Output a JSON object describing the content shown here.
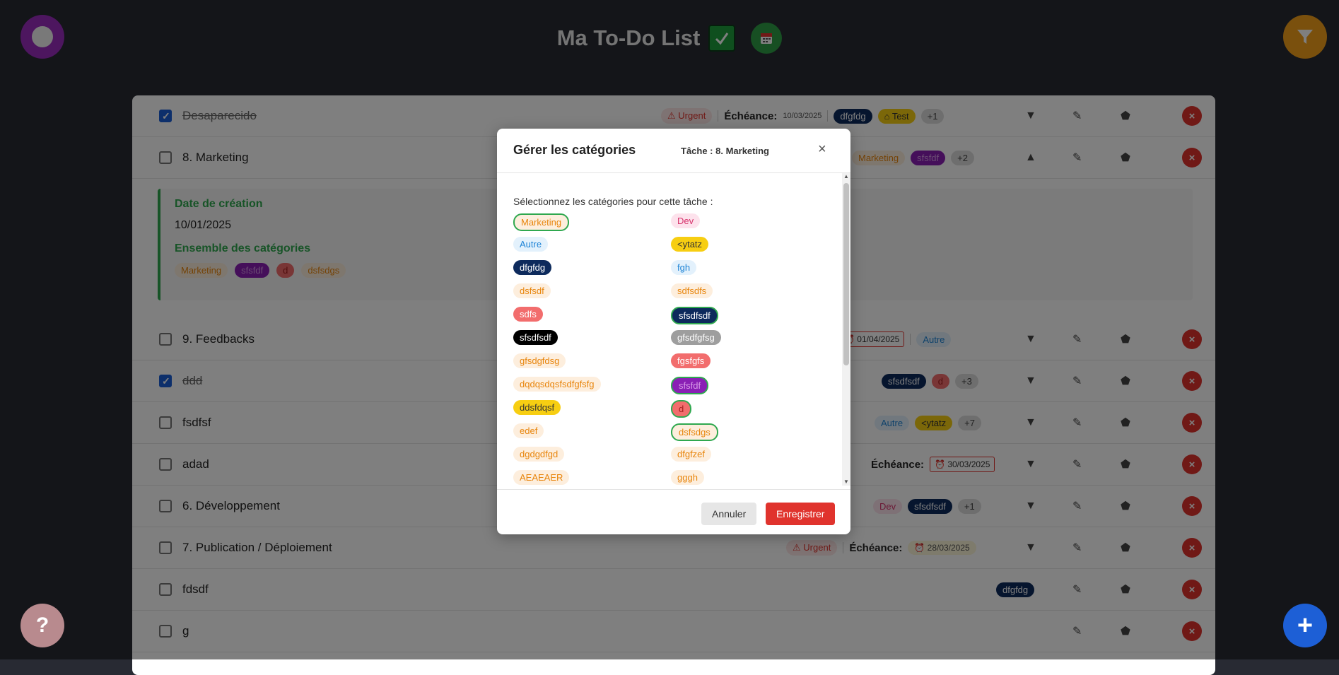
{
  "app": {
    "title": "Ma To-Do List"
  },
  "help_label": "?",
  "add_label": "+",
  "due_label": "Échéance:",
  "tasks": [
    {
      "name": "Desaparecido",
      "done": true,
      "urgent": "Urgent",
      "due": "10/03/2025",
      "chips": [
        "dfgfdg",
        "Test",
        "+1"
      ]
    },
    {
      "name": "8. Marketing",
      "done": false,
      "chips": [
        "Marketing",
        "sfsfdf",
        "+2"
      ]
    },
    {
      "name": "9. Feedbacks",
      "done": false,
      "due": "01/04/2025",
      "chips": [
        "Autre"
      ]
    },
    {
      "name": "ddd",
      "done": true,
      "chips": [
        "sfsdfsdf",
        "d",
        "+3"
      ]
    },
    {
      "name": "fsdfsf",
      "done": false,
      "chips": [
        "Autre",
        "<ytatz",
        "+7"
      ]
    },
    {
      "name": "adad",
      "done": false,
      "due": "30/03/2025"
    },
    {
      "name": "6. Développement",
      "done": false,
      "chips": [
        "Dev",
        "sfsdfsdf",
        "+1"
      ]
    },
    {
      "name": "7. Publication / Déploiement",
      "done": false,
      "urgent": "Urgent",
      "due": "28/03/2025"
    },
    {
      "name": "fdsdf",
      "done": false,
      "chips": [
        "dfgfdg"
      ]
    },
    {
      "name": "g",
      "done": false
    }
  ],
  "detail": {
    "created_label": "Date de création",
    "created_value": "10/01/2025",
    "cats_label": "Ensemble des catégories",
    "cats": [
      "Marketing",
      "sfsfdf",
      "d",
      "dsfsdgs"
    ]
  },
  "modal": {
    "title": "Gérer les catégories",
    "subtitle": "Tâche : 8. Marketing",
    "close": "×",
    "instruction": "Sélectionnez les catégories pour cette tâche :",
    "categories": [
      {
        "label": "Marketing",
        "bg": "#fdeedd",
        "fg": "#e8850c",
        "selected": true
      },
      {
        "label": "Dev",
        "bg": "#fde2ec",
        "fg": "#d6336c",
        "selected": false
      },
      {
        "label": "Autre",
        "bg": "#e3f1fc",
        "fg": "#1f84d6",
        "selected": false
      },
      {
        "label": "<ytatz",
        "bg": "#f7ce12",
        "fg": "#333333",
        "selected": false
      },
      {
        "label": "dfgfdg",
        "bg": "#0d2a5c",
        "fg": "#ffffff",
        "selected": false
      },
      {
        "label": "fgh",
        "bg": "#e3f1fc",
        "fg": "#1f84d6",
        "selected": false
      },
      {
        "label": "dsfsdf",
        "bg": "#fdeedd",
        "fg": "#e8850c",
        "selected": false
      },
      {
        "label": "sdfsdfs",
        "bg": "#fdeedd",
        "fg": "#e8850c",
        "selected": false
      },
      {
        "label": "sdfs",
        "bg": "#f26d6d",
        "fg": "#ffffff",
        "selected": false
      },
      {
        "label": "sfsdfsdf",
        "bg": "#0d2a5c",
        "fg": "#ffffff",
        "selected": true
      },
      {
        "label": "sfsdfsdf",
        "bg": "#000000",
        "fg": "#ffffff",
        "selected": false
      },
      {
        "label": "gfsdfgfsg",
        "bg": "#9e9e9e",
        "fg": "#ffffff",
        "selected": false
      },
      {
        "label": "gfsdgfdsg",
        "bg": "#fdeedd",
        "fg": "#e8850c",
        "selected": false
      },
      {
        "label": "fgsfgfs",
        "bg": "#f26d6d",
        "fg": "#ffffff",
        "selected": false
      },
      {
        "label": "dqdqsdqsfsdfgfsfg",
        "bg": "#fdeedd",
        "fg": "#e8850c",
        "selected": false
      },
      {
        "label": "sfsfdf",
        "bg": "#8a1fb5",
        "fg": "#d89be8",
        "selected": true
      },
      {
        "label": "ddsfdqsf",
        "bg": "#f7ce12",
        "fg": "#333333",
        "selected": false
      },
      {
        "label": "d",
        "bg": "#f26d6d",
        "fg": "#a11d1d",
        "selected": true
      },
      {
        "label": "edef",
        "bg": "#fdeedd",
        "fg": "#e8850c",
        "selected": false
      },
      {
        "label": "dsfsdgs",
        "bg": "#fdeedd",
        "fg": "#e8850c",
        "selected": true
      },
      {
        "label": "dgdgdfgd",
        "bg": "#fdeedd",
        "fg": "#e8850c",
        "selected": false
      },
      {
        "label": "dfgfzef",
        "bg": "#fdeedd",
        "fg": "#e8850c",
        "selected": false
      },
      {
        "label": "AEAEAER",
        "bg": "#fdeedd",
        "fg": "#e8850c",
        "selected": false
      },
      {
        "label": "gggh",
        "bg": "#fdeedd",
        "fg": "#e8850c",
        "selected": false
      }
    ],
    "cancel_label": "Annuler",
    "save_label": "Enregistrer"
  },
  "colors": {
    "accent_green": "#2fa84f",
    "danger_red": "#e0332d",
    "primary_blue": "#1d5fd6",
    "profile_purple": "#9b2cbf",
    "filter_orange": "#f5a01a"
  }
}
